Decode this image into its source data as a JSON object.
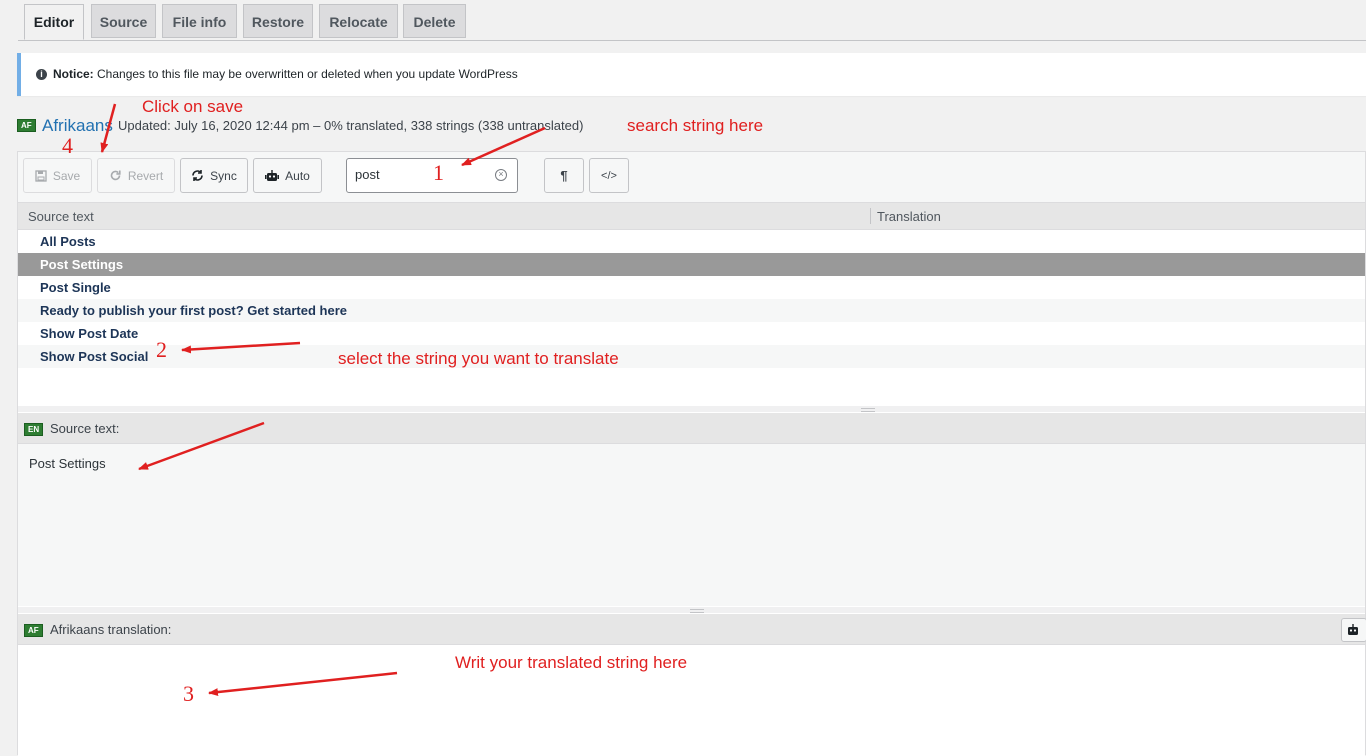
{
  "tabs": [
    "Editor",
    "Source",
    "File info",
    "Restore",
    "Relocate",
    "Delete"
  ],
  "notice": {
    "prefix": "Notice:",
    "text": "Changes to this file may be overwritten or deleted when you update WordPress"
  },
  "locale": {
    "flag": "AF",
    "name": "Afrikaans",
    "status": "Updated: July 16, 2020 12:44 pm – 0% translated, 338 strings (338 untranslated)"
  },
  "toolbar": {
    "save": "Save",
    "revert": "Revert",
    "sync": "Sync",
    "auto": "Auto",
    "search_value": "post"
  },
  "list": {
    "col_source": "Source text",
    "col_translation": "Translation",
    "rows": [
      "All Posts",
      "Post Settings",
      "Post Single",
      "Ready to publish your first post? Get started here",
      "Show Post Date",
      "Show Post Social"
    ],
    "selected_index": 1
  },
  "source_pane": {
    "flag": "EN",
    "label": "Source text:",
    "text": "Post Settings"
  },
  "translation_pane": {
    "flag": "AF",
    "label": "Afrikaans translation:"
  },
  "annotations": {
    "click_save": "Click on save",
    "search_here": "search string here",
    "select_string": "select the string you want to translate",
    "write_here": "Writ your translated string here",
    "n1": "1",
    "n2": "2",
    "n3": "3",
    "n4": "4"
  },
  "colors": {
    "annotation": "#e02020",
    "selected_row": "#999999",
    "link": "#2271b1",
    "flag_bg": "#2e7d32"
  }
}
